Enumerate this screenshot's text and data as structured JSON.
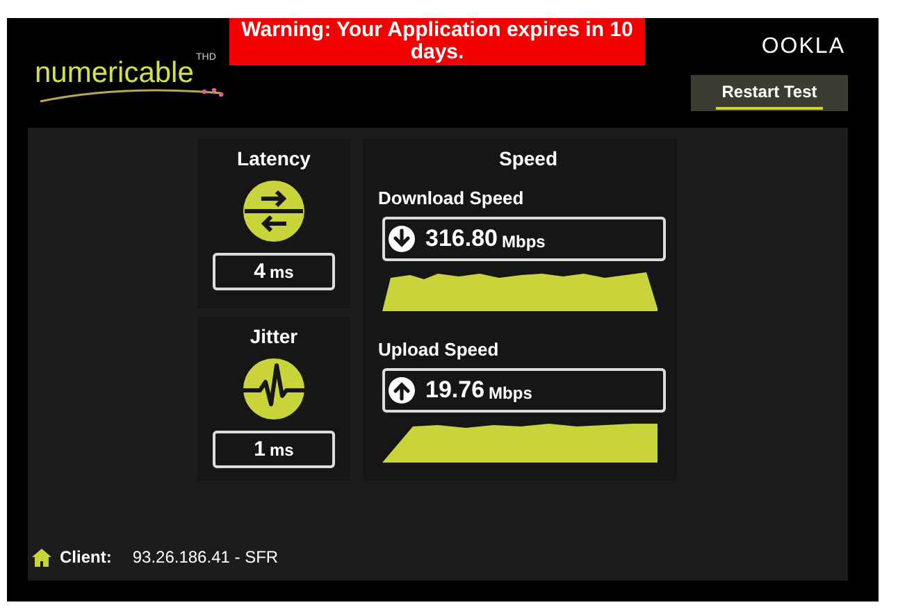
{
  "header": {
    "logo": "numericable",
    "logo_badge": "THD",
    "warning": "Warning: Your Application expires in 10 days.",
    "brand": "OOKLA",
    "restart_button": "Restart Test"
  },
  "latency": {
    "title": "Latency",
    "value": "4",
    "unit": "ms"
  },
  "jitter": {
    "title": "Jitter",
    "value": "1",
    "unit": "ms"
  },
  "speed": {
    "title": "Speed",
    "tests": [
      {
        "kind": "download",
        "label": "Download Speed",
        "value": "316.80",
        "unit": "Mbps"
      },
      {
        "kind": "upload",
        "label": "Upload Speed",
        "value": "19.76",
        "unit": "Mbps"
      }
    ]
  },
  "client": {
    "label": "Client:",
    "value": "93.26.186.41 - SFR"
  }
}
